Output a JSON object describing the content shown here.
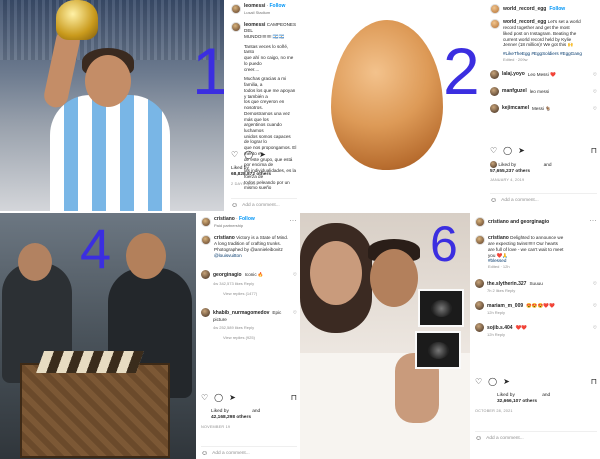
{
  "panel1": {
    "number": "1",
    "header": {
      "username": "leomessi",
      "follow": "Follow",
      "location": "Lusail Stadium"
    },
    "caption_user": "leomessi",
    "caption_lines": [
      "CAMPEONES DEL",
      "MUNDO!!!!!!!! 🇦🇷🇦🇷",
      "",
      "Tantas veces lo soñé, tanto",
      "que ahí no caigo, no me lo puedo",
      "creer....",
      "",
      "Muchas gracias a mi familia, a",
      "todos los que me apoyan y también a",
      "los que creyeron en nosotros.",
      "Demostramos una vez más que los",
      "argentinos cuando luchamos",
      "unidos somos capaces de lograr lo",
      "que nos propongamos. El mérito es",
      "de este grupo, que está por encima de",
      "las individualidades, es la fuerza de",
      "todos peleando por un mismo sueño"
    ],
    "liked_by": "Liked by",
    "likes": "68,828,872 others",
    "date": "2 DAYS AGO",
    "add_comment": "Add a comment..."
  },
  "panel2": {
    "number": "2",
    "header": {
      "username": "world_record_egg",
      "follow": "Follow",
      "location": ""
    },
    "caption_user": "world_record_egg",
    "caption_lines": [
      "Let's set a world",
      "record together and get the most",
      "liked post on Instagram. Beating the",
      "current world record held by Kylie",
      "Jenner (18 million)! We got this 🙌"
    ],
    "hashtags": "#LikeTheEgg #EggSoldiers #EggGang",
    "edited": "Edited · 209w",
    "comments": [
      {
        "user": "lalaj.yoyo",
        "text": "Leo Messi ❤️",
        "meta": ""
      },
      {
        "user": "manfguzel",
        "text": "leo messi",
        "meta": ""
      },
      {
        "user": "kejimcamel",
        "text": "Messi 🐐",
        "meta": ""
      }
    ],
    "liked_by": "Liked by",
    "and": "and",
    "likes": "57,655,237 others",
    "date": "JANUARY 4, 2019",
    "add_comment": "Add a comment..."
  },
  "panel4": {
    "number": "4",
    "header": {
      "username": "cristiano",
      "follow": "Follow",
      "location": "Paid partnership"
    },
    "caption_user": "cristiano",
    "caption_lines": [
      "Victory is a State of Mind.",
      "A long tradition of crafting trunks.",
      "Photographed by @annieleibovitz",
      "@louisvuitton"
    ],
    "comments": [
      {
        "user": "georginagio",
        "text": "Iconic 🔥",
        "meta": "4w   342,573 likes   Reply",
        "replies": "View replies (1477)"
      },
      {
        "user": "khabib_nurmagomedov",
        "text": "Epic",
        "text2": "picture",
        "meta": "4w   252,589 likes   Reply",
        "replies": "View replies (925)"
      }
    ],
    "liked_by": "Liked by",
    "and": "and",
    "likes": "42,168,298 others",
    "date": "NOVEMBER 19",
    "add_comment": "Add a comment..."
  },
  "panel6": {
    "number": "6",
    "header": {
      "username": "cristiano",
      "follow": "",
      "location": ""
    },
    "header_line": "cristiano and georginagio",
    "caption_user": "cristiano",
    "caption_lines": [
      "Delighted to announce we",
      "are expecting twins!!!!!! Our hearts",
      "are full of love - we can't wait to meet",
      "you ❤️🙏",
      "#blessed"
    ],
    "edited": "Edited · 12h",
    "comments": [
      {
        "user": "the.slytherin.327",
        "text": "Suuuu",
        "meta": "7h   2 likes   Reply"
      },
      {
        "user": "mariam_m_009",
        "text": "😍😍😍❤️❤️",
        "meta": "12h   Reply"
      },
      {
        "user": "sojib.s.404",
        "text": "❤️❤️",
        "meta": "12h   Reply"
      }
    ],
    "liked_by": "Liked by",
    "and": "and",
    "likes": "32,666,107 others",
    "date": "OCTOBER 28, 2021",
    "add_comment": "Add a comment..."
  }
}
